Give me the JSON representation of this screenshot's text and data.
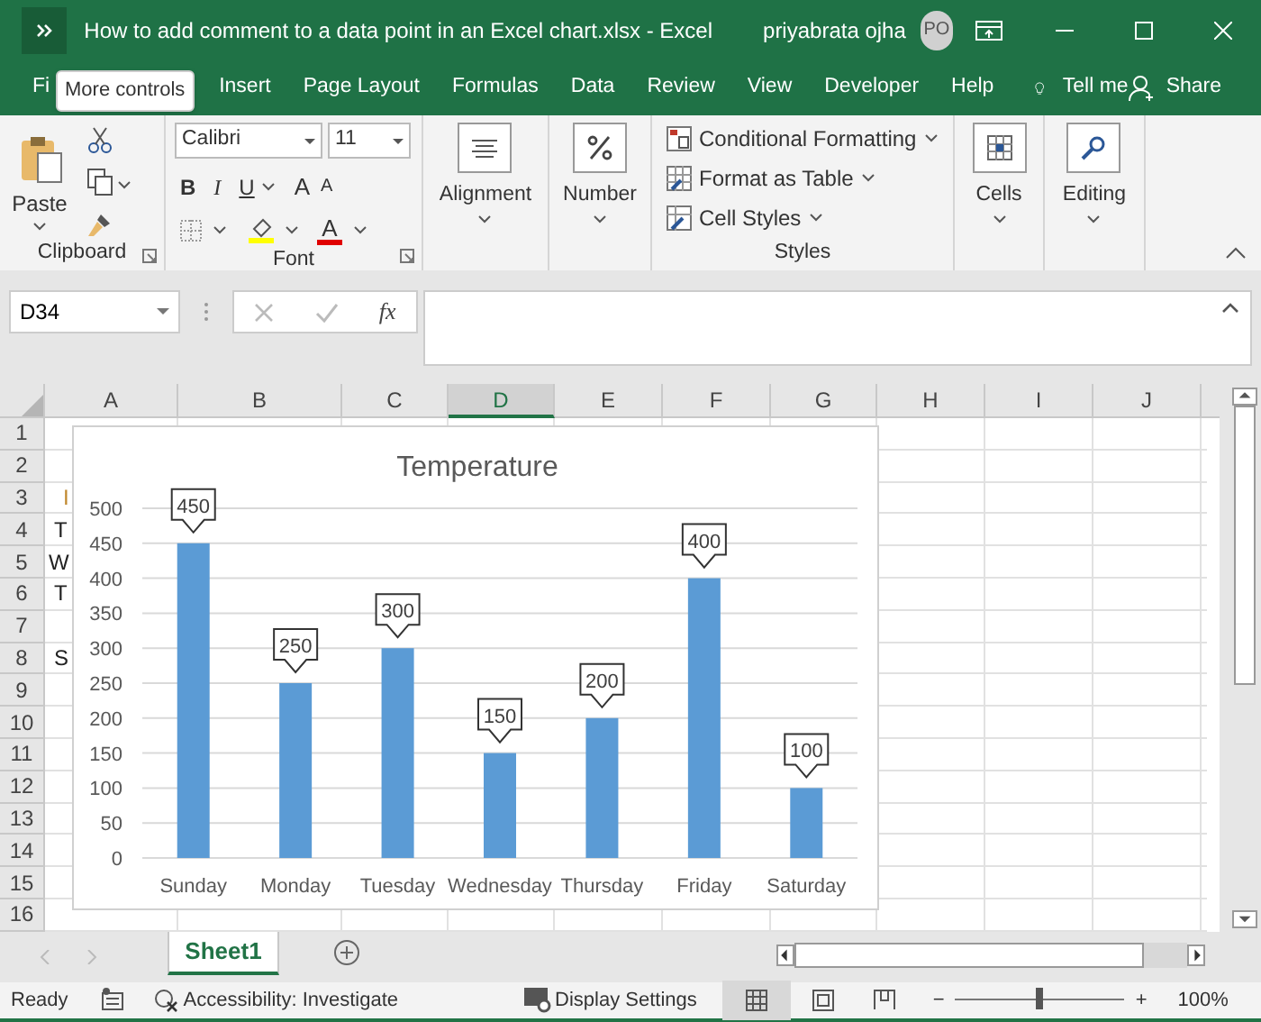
{
  "window": {
    "title": "How to add comment to a data point in an Excel chart.xlsx  -  Excel",
    "user": "priyabrata ojha",
    "avatar_initials": "PO"
  },
  "ribbon_tabs": [
    {
      "label": "Fi"
    },
    {
      "label": "Insert"
    },
    {
      "label": "Page Layout"
    },
    {
      "label": "Formulas"
    },
    {
      "label": "Data"
    },
    {
      "label": "Review"
    },
    {
      "label": "View"
    },
    {
      "label": "Developer"
    },
    {
      "label": "Help"
    }
  ],
  "tell_me": "Tell me",
  "share": "Share",
  "tooltip": "More controls",
  "ribbon": {
    "clipboard": {
      "paste": "Paste",
      "label": "Clipboard"
    },
    "font": {
      "name": "Calibri",
      "size": "11",
      "bold": "B",
      "italic": "I",
      "underline": "U",
      "grow": "A",
      "shrink": "A",
      "font_color": "A",
      "label": "Font"
    },
    "alignment": "Alignment",
    "number": "Number",
    "styles": {
      "items": [
        "Conditional Formatting",
        "Format as Table",
        "Cell Styles"
      ],
      "label": "Styles"
    },
    "cells": "Cells",
    "editing": "Editing"
  },
  "name_box": "D34",
  "function_button": "fx",
  "columns": [
    {
      "label": "A",
      "selected": false
    },
    {
      "label": "B",
      "selected": false
    },
    {
      "label": "C",
      "selected": false
    },
    {
      "label": "D",
      "selected": true
    },
    {
      "label": "E",
      "selected": false
    },
    {
      "label": "F",
      "selected": false
    },
    {
      "label": "G",
      "selected": false
    },
    {
      "label": "H",
      "selected": false
    },
    {
      "label": "I",
      "selected": false
    },
    {
      "label": "J",
      "selected": false
    }
  ],
  "rows": [
    {
      "number": "1"
    },
    {
      "number": "2"
    },
    {
      "number": "3",
      "cell_a": "I"
    },
    {
      "number": "4",
      "cell_a": "T"
    },
    {
      "number": "5",
      "cell_a": "W"
    },
    {
      "number": "6",
      "cell_a": "T"
    },
    {
      "number": "7"
    },
    {
      "number": "8",
      "cell_a": "S"
    },
    {
      "number": "9"
    },
    {
      "number": "10"
    },
    {
      "number": "11"
    },
    {
      "number": "12"
    },
    {
      "number": "13"
    },
    {
      "number": "14"
    },
    {
      "number": "15"
    },
    {
      "number": "16"
    }
  ],
  "chart": {
    "chart_data": {
      "type": "bar",
      "title": "Temperature",
      "categories": [
        "Sunday",
        "Monday",
        "Tuesday",
        "Wednesday",
        "Thursday",
        "Friday",
        "Saturday"
      ],
      "series": [
        {
          "color": "#5b9bd5",
          "values": [
            450,
            250,
            300,
            150,
            200,
            400,
            100
          ]
        }
      ],
      "ylim": [
        0,
        500
      ],
      "yticks": [
        0,
        50,
        100,
        150,
        200,
        250,
        300,
        350,
        400,
        450,
        500
      ],
      "grid": true,
      "data_labels": true
    }
  },
  "sheet_tabs": [
    {
      "label": "Sheet1",
      "selected": true
    }
  ],
  "status_bar": {
    "ready": "Ready",
    "accessibility": "Accessibility: Investigate",
    "display_settings": "Display Settings",
    "zoom_minus": "−",
    "zoom_plus": "+",
    "zoom": "100%",
    "zoom_slider": {
      "level": 0.5
    }
  }
}
